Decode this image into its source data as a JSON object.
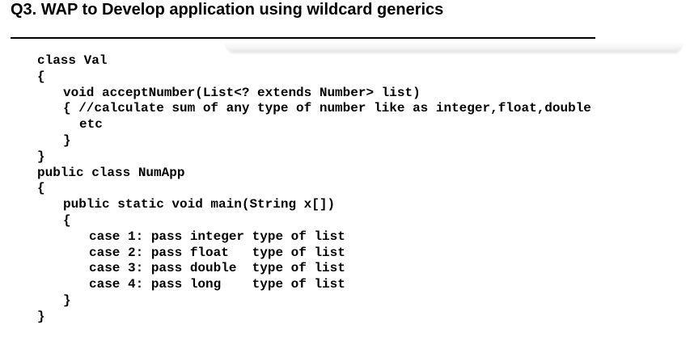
{
  "heading": "Q3. WAP to Develop application using wildcard generics",
  "code_lines": [
    "class Val",
    "{",
    "void acceptNumber(List<? extends Number> list)",
    "{ //calculate sum of any type of number like as integer,float,double",
    "etc",
    "}",
    "}",
    "public class NumApp",
    "{",
    "public static void main(String x[])",
    "{",
    "case 1: pass integer type of list",
    "case 2: pass float   type of list",
    "case 3: pass double  type of list",
    "case 4: pass long    type of list",
    "}",
    "}"
  ]
}
